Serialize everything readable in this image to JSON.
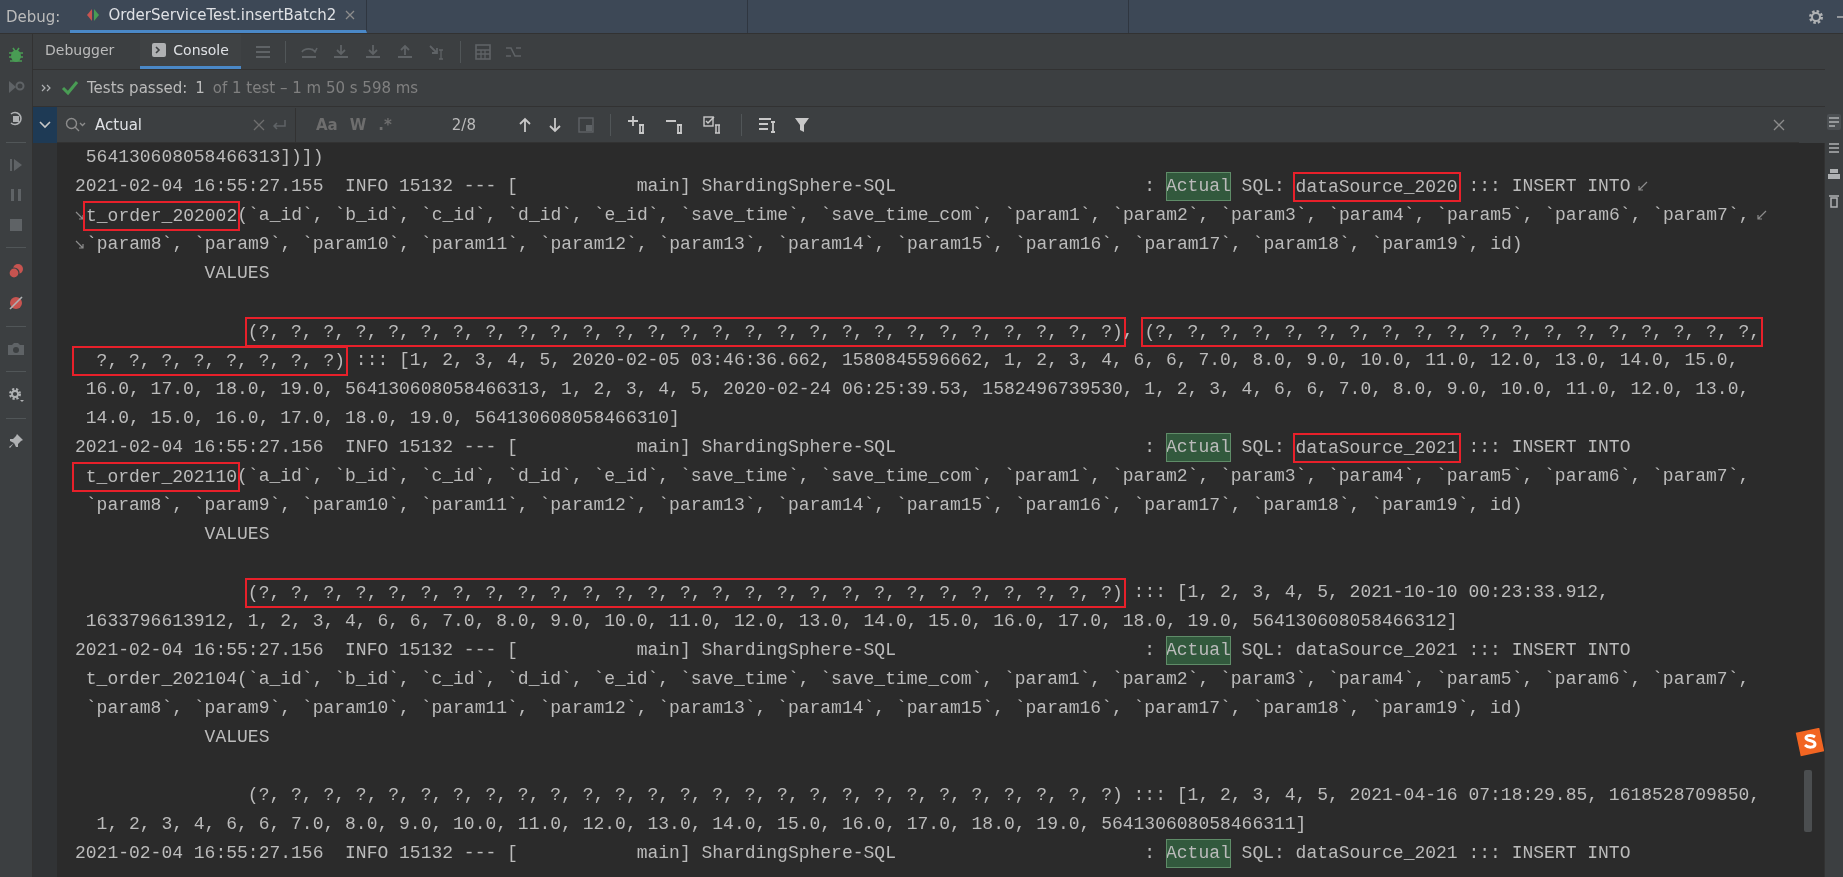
{
  "window": {
    "label": "Debug:",
    "tab": {
      "title": "OrderServiceTest.insertBatch2",
      "selected": true
    }
  },
  "tabs": [
    {
      "label": "Debugger",
      "selected": false
    },
    {
      "label": "Console",
      "selected": true
    }
  ],
  "test_status": {
    "passed": true,
    "label": "Tests passed:",
    "count": "1",
    "detail": "of 1 test – 1 m 50 s 598 ms"
  },
  "search": {
    "value": "Actual",
    "match_count": "2/8",
    "options": [
      {
        "label": "Aa",
        "selected": false
      },
      {
        "label": "W",
        "selected": false
      },
      {
        "label": ".*",
        "selected": false
      }
    ]
  },
  "console": {
    "lines": [
      {
        "wrap_in": false,
        "wrap_out": false,
        "segments": [
          {
            "kind": "plain",
            "text": " 564130608058466313])])"
          }
        ]
      },
      {
        "wrap_in": false,
        "wrap_out": true,
        "segments": [
          {
            "kind": "plain",
            "text": "2021-02-04 16:55:27.155  INFO 15132 --- [           main] ShardingSphere-SQL                       : "
          },
          {
            "kind": "match",
            "text": "Actual"
          },
          {
            "kind": "plain",
            "text": " SQL: "
          },
          {
            "kind": "boxed",
            "text": "dataSource_2020"
          },
          {
            "kind": "plain",
            "text": " ::: INSERT INTO"
          }
        ]
      },
      {
        "wrap_in": true,
        "wrap_out": true,
        "segments": [
          {
            "kind": "boxed",
            "text": "t_order_202002"
          },
          {
            "kind": "plain",
            "text": "(`a_id`, `b_id`, `c_id`, `d_id`, `e_id`, `save_time`, `save_time_com`, `param1`, `param2`, `param3`, `param4`, `param5`, `param6`, `param7`,"
          }
        ]
      },
      {
        "wrap_in": true,
        "wrap_out": false,
        "segments": [
          {
            "kind": "plain",
            "text": "`param8`, `param9`, `param10`, `param11`, `param12`, `param13`, `param14`, `param15`, `param16`, `param17`, `param18`, `param19`, id)"
          }
        ]
      },
      {
        "wrap_in": false,
        "wrap_out": false,
        "segments": [
          {
            "kind": "plain",
            "text": "            VALUES"
          }
        ]
      },
      {
        "wrap_in": false,
        "wrap_out": false
      },
      {
        "kind": "values",
        "wrap_in": false,
        "wrap_out": false,
        "segments": [
          {
            "kind": "boxed",
            "text": "(?, ?, ?, ?, ?, ?, ?, ?, ?, ?, ?, ?, ?, ?, ?, ?, ?, ?, ?, ?, ?, ?, ?, ?, ?, ?, ?)"
          },
          {
            "kind": "plain",
            "text": ", "
          },
          {
            "kind": "boxed",
            "text": "(?, ?, ?, ?, ?, ?, ?, ?, ?, ?, ?, ?, ?, ?, ?, ?, ?, ?, ?,"
          }
        ]
      },
      {
        "wrap_in": false,
        "wrap_out": false,
        "segments": [
          {
            "kind": "boxed",
            "text": "  ?, ?, ?, ?, ?, ?, ?, ?)"
          },
          {
            "kind": "plain",
            "text": " ::: [1, 2, 3, 4, 5, 2020-02-05 03:46:36.662, 1580845596662, 1, 2, 3, 4, 6, 6, 7.0, 8.0, 9.0, 10.0, 11.0, 12.0, 13.0, 14.0, 15.0,"
          }
        ]
      },
      {
        "wrap_in": false,
        "wrap_out": false,
        "segments": [
          {
            "kind": "plain",
            "text": " 16.0, 17.0, 18.0, 19.0, 564130608058466313, 1, 2, 3, 4, 5, 2020-02-24 06:25:39.53, 1582496739530, 1, 2, 3, 4, 6, 6, 7.0, 8.0, 9.0, 10.0, 11.0, 12.0, 13.0,"
          }
        ]
      },
      {
        "wrap_in": false,
        "wrap_out": false,
        "segments": [
          {
            "kind": "plain",
            "text": " 14.0, 15.0, 16.0, 17.0, 18.0, 19.0, 564130608058466310]"
          }
        ]
      },
      {
        "wrap_in": false,
        "wrap_out": false,
        "segments": [
          {
            "kind": "plain",
            "text": "2021-02-04 16:55:27.156  INFO 15132 --- [           main] ShardingSphere-SQL                       : "
          },
          {
            "kind": "match",
            "text": "Actual"
          },
          {
            "kind": "plain",
            "text": " SQL: "
          },
          {
            "kind": "boxed",
            "text": "dataSource_2021"
          },
          {
            "kind": "plain",
            "text": " ::: INSERT INTO"
          }
        ]
      },
      {
        "wrap_in": false,
        "wrap_out": false,
        "segments": [
          {
            "kind": "boxed",
            "text": " t_order_202110"
          },
          {
            "kind": "plain",
            "text": "(`a_id`, `b_id`, `c_id`, `d_id`, `e_id`, `save_time`, `save_time_com`, `param1`, `param2`, `param3`, `param4`, `param5`, `param6`, `param7`,"
          }
        ]
      },
      {
        "wrap_in": false,
        "wrap_out": false,
        "segments": [
          {
            "kind": "plain",
            "text": " `param8`, `param9`, `param10`, `param11`, `param12`, `param13`, `param14`, `param15`, `param16`, `param17`, `param18`, `param19`, id)"
          }
        ]
      },
      {
        "wrap_in": false,
        "wrap_out": false,
        "segments": [
          {
            "kind": "plain",
            "text": "            VALUES"
          }
        ]
      },
      {
        "wrap_in": false,
        "wrap_out": false
      },
      {
        "kind": "values",
        "wrap_in": false,
        "wrap_out": false,
        "segments": [
          {
            "kind": "boxed",
            "text": "(?, ?, ?, ?, ?, ?, ?, ?, ?, ?, ?, ?, ?, ?, ?, ?, ?, ?, ?, ?, ?, ?, ?, ?, ?, ?, ?)"
          },
          {
            "kind": "plain",
            "text": " ::: [1, 2, 3, 4, 5, 2021-10-10 00:23:33.912,"
          }
        ]
      },
      {
        "wrap_in": false,
        "wrap_out": false,
        "segments": [
          {
            "kind": "plain",
            "text": " 1633796613912, 1, 2, 3, 4, 6, 6, 7.0, 8.0, 9.0, 10.0, 11.0, 12.0, 13.0, 14.0, 15.0, 16.0, 17.0, 18.0, 19.0, 564130608058466312]"
          }
        ]
      },
      {
        "wrap_in": false,
        "wrap_out": false,
        "segments": [
          {
            "kind": "plain",
            "text": "2021-02-04 16:55:27.156  INFO 15132 --- [           main] ShardingSphere-SQL                       : "
          },
          {
            "kind": "match",
            "text": "Actual"
          },
          {
            "kind": "plain",
            "text": " SQL: dataSource_2021 ::: INSERT INTO"
          }
        ]
      },
      {
        "wrap_in": false,
        "wrap_out": false,
        "segments": [
          {
            "kind": "plain",
            "text": " t_order_202104(`a_id`, `b_id`, `c_id`, `d_id`, `e_id`, `save_time`, `save_time_com`, `param1`, `param2`, `param3`, `param4`, `param5`, `param6`, `param7`,"
          }
        ]
      },
      {
        "wrap_in": false,
        "wrap_out": false,
        "segments": [
          {
            "kind": "plain",
            "text": " `param8`, `param9`, `param10`, `param11`, `param12`, `param13`, `param14`, `param15`, `param16`, `param17`, `param18`, `param19`, id)"
          }
        ]
      },
      {
        "wrap_in": false,
        "wrap_out": false,
        "segments": [
          {
            "kind": "plain",
            "text": "            VALUES"
          }
        ]
      },
      {
        "wrap_in": false,
        "wrap_out": false
      },
      {
        "kind": "values",
        "wrap_in": false,
        "wrap_out": false,
        "segments": [
          {
            "kind": "plain",
            "text": "(?, ?, ?, ?, ?, ?, ?, ?, ?, ?, ?, ?, ?, ?, ?, ?, ?, ?, ?, ?, ?, ?, ?, ?, ?, ?, ?) ::: [1, 2, 3, 4, 5, 2021-04-16 07:18:29.85, 1618528709850,"
          }
        ]
      },
      {
        "wrap_in": false,
        "wrap_out": false,
        "segments": [
          {
            "kind": "plain",
            "text": "  1, 2, 3, 4, 6, 6, 7.0, 8.0, 9.0, 10.0, 11.0, 12.0, 13.0, 14.0, 15.0, 16.0, 17.0, 18.0, 19.0, 564130608058466311]"
          }
        ]
      },
      {
        "wrap_in": false,
        "wrap_out": false,
        "segments": [
          {
            "kind": "plain",
            "text": "2021-02-04 16:55:27.156  INFO 15132 --- [           main] ShardingSphere-SQL                       : "
          },
          {
            "kind": "match",
            "text": "Actual"
          },
          {
            "kind": "plain",
            "text": " SQL: dataSource_2021 ::: INSERT INTO"
          }
        ]
      }
    ]
  }
}
